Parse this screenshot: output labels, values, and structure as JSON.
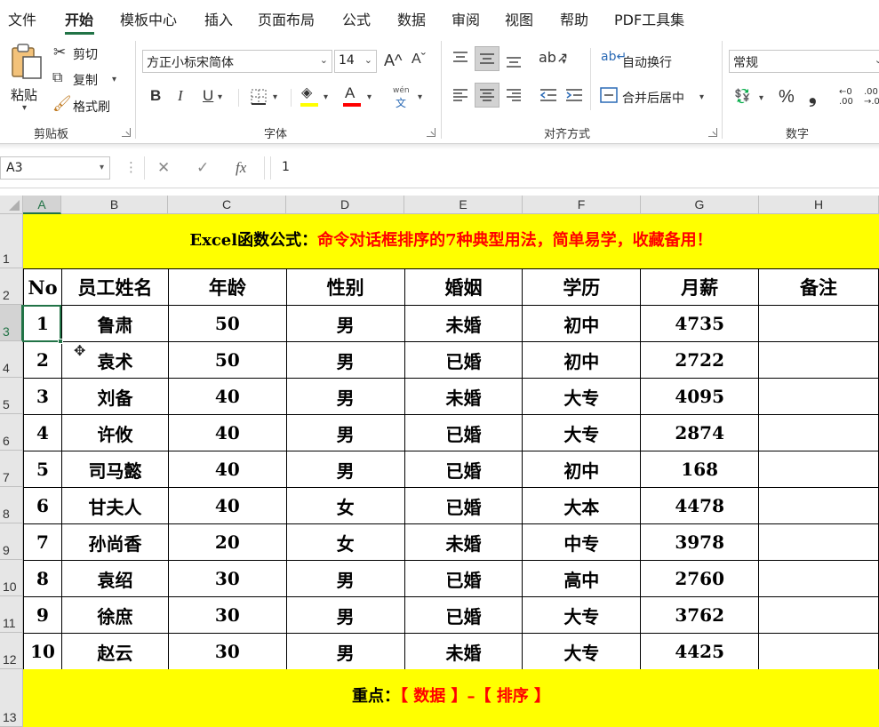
{
  "menu": {
    "items": [
      "文件",
      "开始",
      "模板中心",
      "插入",
      "页面布局",
      "公式",
      "数据",
      "审阅",
      "视图",
      "帮助",
      "PDF工具集"
    ],
    "active": "开始"
  },
  "ribbon": {
    "clipboard": {
      "paste_label": "粘贴",
      "cut_label": "剪切",
      "copy_label": "复制",
      "format_painter_label": "格式刷",
      "group_label": "剪贴板"
    },
    "font": {
      "font_name": "方正小标宋简体",
      "font_size": "14",
      "grow_label": "A^",
      "shrink_label": "Aˇ",
      "bold_label": "B",
      "italic_label": "I",
      "underline_label": "U",
      "font_color_label": "A",
      "phonetic_label": "wén",
      "group_label": "字体"
    },
    "alignment": {
      "wrap_text_label": "自动换行",
      "merge_center_label": "合并后居中",
      "group_label": "对齐方式"
    },
    "number": {
      "format_value": "常规",
      "percent_label": "%",
      "comma_label": "❟",
      "group_label": "数字"
    }
  },
  "formula_bar": {
    "name_box": "A3",
    "cancel_symbol": "✕",
    "enter_symbol": "✓",
    "fx_label": "fx",
    "value": "1"
  },
  "sheet": {
    "columns": [
      "A",
      "B",
      "C",
      "D",
      "E",
      "F",
      "G",
      "H"
    ],
    "rows": [
      "1",
      "2",
      "3",
      "4",
      "5",
      "6",
      "7",
      "8",
      "9",
      "10",
      "11",
      "12",
      "13"
    ],
    "active_column": "A",
    "active_row": "3",
    "title_black": "Excel函数公式：",
    "title_red": "命令对话框排序的7种典型用法，简单易学，收藏备用！",
    "headers": [
      "No",
      "员工姓名",
      "年龄",
      "性别",
      "婚姻",
      "学历",
      "月薪",
      "备注"
    ],
    "records": [
      [
        "1",
        "鲁肃",
        "50",
        "男",
        "未婚",
        "初中",
        "4735",
        ""
      ],
      [
        "2",
        "袁术",
        "50",
        "男",
        "已婚",
        "初中",
        "2722",
        ""
      ],
      [
        "3",
        "刘备",
        "40",
        "男",
        "未婚",
        "大专",
        "4095",
        ""
      ],
      [
        "4",
        "许攸",
        "40",
        "男",
        "已婚",
        "大专",
        "2874",
        ""
      ],
      [
        "5",
        "司马懿",
        "40",
        "男",
        "已婚",
        "初中",
        "168",
        ""
      ],
      [
        "6",
        "甘夫人",
        "40",
        "女",
        "已婚",
        "大本",
        "4478",
        ""
      ],
      [
        "7",
        "孙尚香",
        "20",
        "女",
        "未婚",
        "中专",
        "3978",
        ""
      ],
      [
        "8",
        "袁绍",
        "30",
        "男",
        "已婚",
        "高中",
        "2760",
        ""
      ],
      [
        "9",
        "徐庶",
        "30",
        "男",
        "已婚",
        "大专",
        "3762",
        ""
      ],
      [
        "10",
        "赵云",
        "30",
        "男",
        "未婚",
        "大专",
        "4425",
        ""
      ]
    ],
    "note_black": "重点：",
    "note_red": "【 数据 】–【 排序 】"
  },
  "colors": {
    "accent": "#217346",
    "highlight_yellow": "#ffff00",
    "title_red": "#ff0000"
  }
}
